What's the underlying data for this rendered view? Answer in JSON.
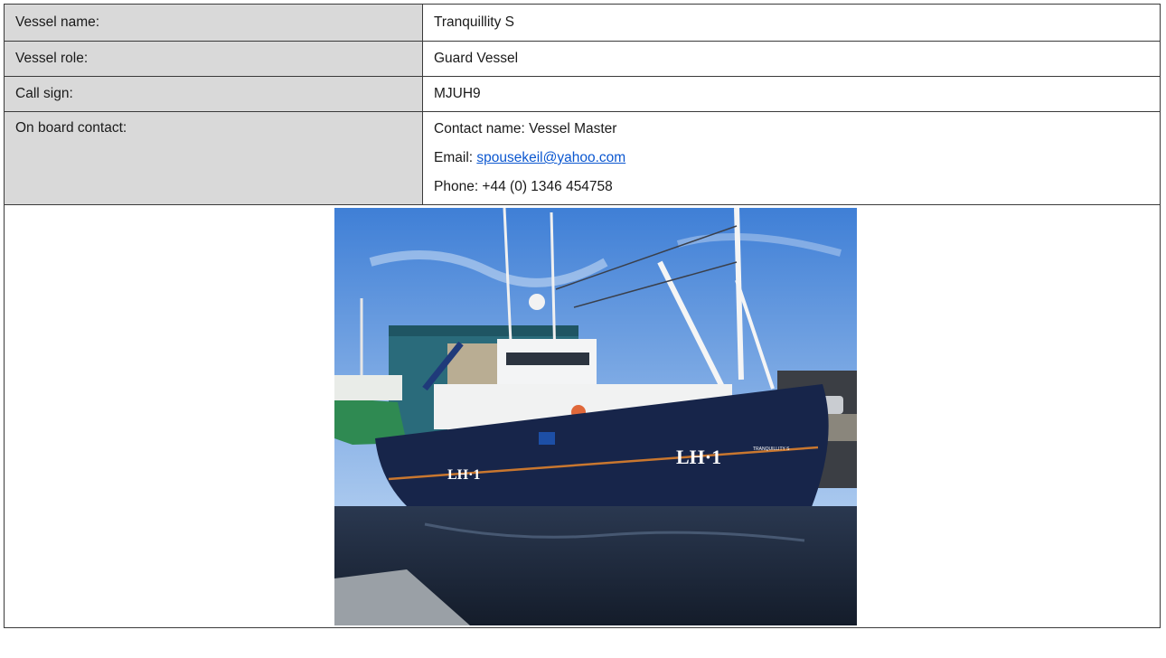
{
  "vessel": {
    "name_label": "Vessel name:",
    "name_value": "Tranquillity S",
    "role_label": "Vessel role:",
    "role_value": "Guard Vessel",
    "callsign_label": "Call sign:",
    "callsign_value": "MJUH9",
    "contact_label": "On board contact:",
    "contact_name": "Contact name: Vessel Master",
    "email_prefix": "Email: ",
    "email": "spousekeil@yahoo.com",
    "phone": "Phone: +44 (0) 1346 454758"
  },
  "photo": {
    "hull_number_bow": "LH·1",
    "hull_number_stern": "LH·1",
    "hull_name": "TRANQUILLITY S",
    "colors": {
      "sky_top": "#3f7fd6",
      "sky_bottom": "#a9c8ee",
      "hull": "#17254a",
      "water": "#1f2a3c",
      "shed": "#2a6b7b"
    }
  }
}
